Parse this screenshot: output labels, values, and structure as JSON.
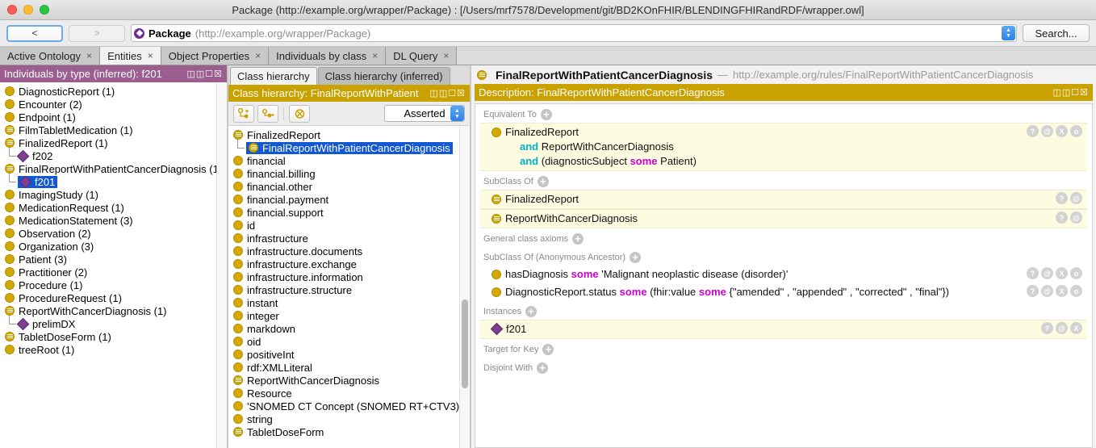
{
  "window": {
    "title": "Package (http://example.org/wrapper/Package)  : [/Users/mrf7578/Development/git/BD2KOnFHIR/BLENDINGFHIRandRDF/wrapper.owl]"
  },
  "toolbar": {
    "back_label": "<",
    "forward_label": ">",
    "entity_name": "Package",
    "entity_iri": "(http://example.org/wrapper/Package)",
    "search_label": "Search..."
  },
  "tabs": [
    {
      "label": "Active Ontology",
      "selected": false
    },
    {
      "label": "Entities",
      "selected": true
    },
    {
      "label": "Object Properties",
      "selected": false
    },
    {
      "label": "Individuals by class",
      "selected": false
    },
    {
      "label": "DL Query",
      "selected": false
    }
  ],
  "left_panel": {
    "title": "Individuals by type (inferred): f201",
    "items": [
      {
        "label": "DiagnosticReport (1)",
        "icon": "circle",
        "indent": 0,
        "selected": false
      },
      {
        "label": "Encounter (2)",
        "icon": "circle",
        "indent": 0,
        "selected": false
      },
      {
        "label": "Endpoint (1)",
        "icon": "circle",
        "indent": 0,
        "selected": false
      },
      {
        "label": "FilmTabletMedication (1)",
        "icon": "classdef",
        "indent": 0,
        "selected": false
      },
      {
        "label": "FinalizedReport (1)",
        "icon": "classdef",
        "indent": 0,
        "selected": false
      },
      {
        "label": "f202",
        "icon": "diamond",
        "indent": 1,
        "selected": false
      },
      {
        "label": "FinalReportWithPatientCancerDiagnosis (1",
        "icon": "classdef",
        "indent": 0,
        "selected": false
      },
      {
        "label": "f201",
        "icon": "diamond",
        "indent": 1,
        "selected": true
      },
      {
        "label": "ImagingStudy (1)",
        "icon": "circle",
        "indent": 0,
        "selected": false
      },
      {
        "label": "MedicationRequest (1)",
        "icon": "circle",
        "indent": 0,
        "selected": false
      },
      {
        "label": "MedicationStatement (3)",
        "icon": "circle",
        "indent": 0,
        "selected": false
      },
      {
        "label": "Observation (2)",
        "icon": "circle",
        "indent": 0,
        "selected": false
      },
      {
        "label": "Organization (3)",
        "icon": "circle",
        "indent": 0,
        "selected": false
      },
      {
        "label": "Patient (3)",
        "icon": "circle",
        "indent": 0,
        "selected": false
      },
      {
        "label": "Practitioner (2)",
        "icon": "circle",
        "indent": 0,
        "selected": false
      },
      {
        "label": "Procedure (1)",
        "icon": "circle",
        "indent": 0,
        "selected": false
      },
      {
        "label": "ProcedureRequest (1)",
        "icon": "circle",
        "indent": 0,
        "selected": false
      },
      {
        "label": "ReportWithCancerDiagnosis (1)",
        "icon": "classdef",
        "indent": 0,
        "selected": false
      },
      {
        "label": "prelimDX",
        "icon": "diamond",
        "indent": 1,
        "selected": false
      },
      {
        "label": "TabletDoseForm (1)",
        "icon": "classdef",
        "indent": 0,
        "selected": false
      },
      {
        "label": "treeRoot (1)",
        "icon": "circle",
        "indent": 0,
        "selected": false
      }
    ]
  },
  "mid_panel": {
    "tabs": [
      {
        "label": "Class hierarchy",
        "selected": true
      },
      {
        "label": "Class hierarchy (inferred)",
        "selected": false
      }
    ],
    "title": "Class hierarchy: FinalReportWithPatient",
    "dropdown_value": "Asserted",
    "items": [
      {
        "label": "FinalizedReport",
        "icon": "classdef",
        "indent": 0,
        "selected": false
      },
      {
        "label": "FinalReportWithPatientCancerDiagnosis",
        "icon": "classdef",
        "indent": 1,
        "selected": true
      },
      {
        "label": "financial",
        "icon": "circle",
        "indent": 0,
        "selected": false
      },
      {
        "label": "financial.billing",
        "icon": "circle",
        "indent": 0,
        "selected": false
      },
      {
        "label": "financial.other",
        "icon": "circle",
        "indent": 0,
        "selected": false
      },
      {
        "label": "financial.payment",
        "icon": "circle",
        "indent": 0,
        "selected": false
      },
      {
        "label": "financial.support",
        "icon": "circle",
        "indent": 0,
        "selected": false
      },
      {
        "label": "id",
        "icon": "circle",
        "indent": 0,
        "selected": false
      },
      {
        "label": "infrastructure",
        "icon": "circle",
        "indent": 0,
        "selected": false
      },
      {
        "label": "infrastructure.documents",
        "icon": "circle",
        "indent": 0,
        "selected": false
      },
      {
        "label": "infrastructure.exchange",
        "icon": "circle",
        "indent": 0,
        "selected": false
      },
      {
        "label": "infrastructure.information",
        "icon": "circle",
        "indent": 0,
        "selected": false
      },
      {
        "label": "infrastructure.structure",
        "icon": "circle",
        "indent": 0,
        "selected": false
      },
      {
        "label": "instant",
        "icon": "circle",
        "indent": 0,
        "selected": false
      },
      {
        "label": "integer",
        "icon": "circle",
        "indent": 0,
        "selected": false
      },
      {
        "label": "markdown",
        "icon": "circle",
        "indent": 0,
        "selected": false
      },
      {
        "label": "oid",
        "icon": "circle",
        "indent": 0,
        "selected": false
      },
      {
        "label": "positiveInt",
        "icon": "circle",
        "indent": 0,
        "selected": false
      },
      {
        "label": "rdf:XMLLiteral",
        "icon": "circle",
        "indent": 0,
        "selected": false
      },
      {
        "label": "ReportWithCancerDiagnosis",
        "icon": "classdef",
        "indent": 0,
        "selected": false
      },
      {
        "label": "Resource",
        "icon": "circle",
        "indent": 0,
        "selected": false
      },
      {
        "label": "'SNOMED CT Concept (SNOMED RT+CTV3)'",
        "icon": "circle",
        "indent": 0,
        "selected": false
      },
      {
        "label": "string",
        "icon": "circle",
        "indent": 0,
        "selected": false
      },
      {
        "label": "TabletDoseForm",
        "icon": "classdef",
        "indent": 0,
        "selected": false
      }
    ]
  },
  "right_panel": {
    "entity_name": "FinalReportWithPatientCancerDiagnosis",
    "dash": "—",
    "entity_iri": "http://example.org/rules/FinalReportWithPatientCancerDiagnosis",
    "description_title": "Description: FinalReportWithPatientCancerDiagnosis",
    "sections": {
      "equivalent_to": {
        "label": "Equivalent To",
        "rows": [
          {
            "icon": "circle",
            "lines": [
              {
                "segments": [
                  {
                    "t": "FinalizedReport",
                    "k": "n"
                  }
                ]
              },
              {
                "indent": true,
                "segments": [
                  {
                    "t": "and ",
                    "k": "and"
                  },
                  {
                    "t": "ReportWithCancerDiagnosis",
                    "k": "n"
                  }
                ]
              },
              {
                "indent": true,
                "segments": [
                  {
                    "t": "and ",
                    "k": "and"
                  },
                  {
                    "t": "(diagnosticSubject ",
                    "k": "n"
                  },
                  {
                    "t": "some ",
                    "k": "some"
                  },
                  {
                    "t": "Patient)",
                    "k": "n"
                  }
                ]
              }
            ],
            "actions": [
              "?",
              "@",
              "X",
              "o"
            ]
          }
        ]
      },
      "subclass_of": {
        "label": "SubClass Of",
        "rows": [
          {
            "icon": "classdef",
            "lines": [
              {
                "segments": [
                  {
                    "t": "FinalizedReport",
                    "k": "n"
                  }
                ]
              }
            ],
            "actions": [
              "?",
              "@"
            ]
          },
          {
            "icon": "classdef",
            "lines": [
              {
                "segments": [
                  {
                    "t": "ReportWithCancerDiagnosis",
                    "k": "n"
                  }
                ]
              }
            ],
            "actions": [
              "?",
              "@"
            ]
          }
        ]
      },
      "general_class_axioms": {
        "label": "General class axioms",
        "rows": []
      },
      "subclass_anon": {
        "label": "SubClass Of (Anonymous Ancestor)",
        "rows": [
          {
            "icon": "circle",
            "plain": true,
            "lines": [
              {
                "segments": [
                  {
                    "t": "hasDiagnosis ",
                    "k": "n"
                  },
                  {
                    "t": "some ",
                    "k": "some"
                  },
                  {
                    "t": "'Malignant neoplastic disease (disorder)'",
                    "k": "n"
                  }
                ]
              }
            ],
            "actions": [
              "?",
              "@",
              "X",
              "o"
            ]
          },
          {
            "icon": "circle",
            "plain": true,
            "lines": [
              {
                "segments": [
                  {
                    "t": "DiagnosticReport.status ",
                    "k": "n"
                  },
                  {
                    "t": "some ",
                    "k": "some"
                  },
                  {
                    "t": "(fhir:value ",
                    "k": "n"
                  },
                  {
                    "t": "some ",
                    "k": "some"
                  },
                  {
                    "t": "{\"amended\" , \"appended\" , \"corrected\" , \"final\"})",
                    "k": "n"
                  }
                ]
              }
            ],
            "actions": [
              "?",
              "@",
              "X",
              "o"
            ]
          }
        ]
      },
      "instances": {
        "label": "Instances",
        "rows": [
          {
            "icon": "diamond",
            "lines": [
              {
                "segments": [
                  {
                    "t": "f201",
                    "k": "n"
                  }
                ]
              }
            ],
            "actions": [
              "?",
              "@",
              "X"
            ]
          }
        ]
      },
      "target_for_key": {
        "label": "Target for Key",
        "rows": []
      },
      "disjoint_with": {
        "label": "Disjoint With",
        "rows": []
      }
    }
  },
  "colors": {
    "panel_purple": "#9b5e8e",
    "panel_gold": "#c9a100",
    "entity_yellow": "#d4a800",
    "individual_purple": "#7e3f8f",
    "selection_blue": "#1257d4",
    "axiom_bg": "#fdfce0",
    "keyword_and": "#00b0c4",
    "keyword_some": "#cc00cc"
  }
}
